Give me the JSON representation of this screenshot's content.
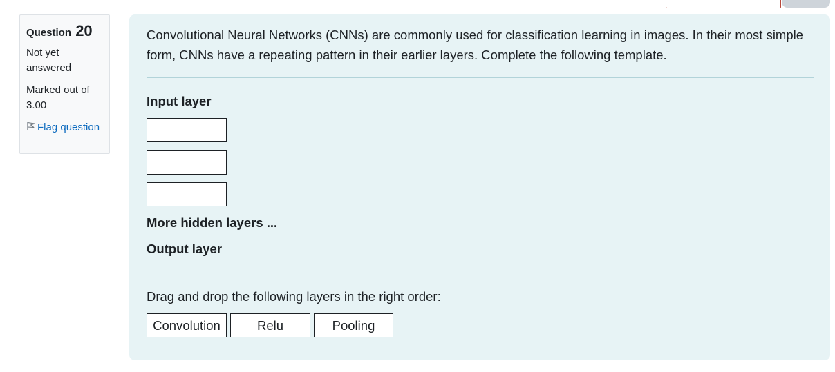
{
  "question": {
    "label": "Question",
    "number": "20",
    "state": "Not yet answered",
    "grade": "Marked out of 3.00",
    "flag_label": "Flag question"
  },
  "content": {
    "question_text": "Convolutional Neural Networks (CNNs) are commonly used for classification learning in images. In their most simple form, CNNs have a repeating pattern in their earlier layers. Complete the following template.",
    "input_layer": "Input layer",
    "more_layers": "More hidden layers ...",
    "output_layer": "Output layer",
    "instruction": "Drag and drop the following layers in the right order:",
    "choices": [
      "Convolution",
      "Relu",
      "Pooling"
    ]
  },
  "icons": {
    "flag": "flag-icon"
  },
  "colors": {
    "link": "#0f6cbf",
    "formulation_bg": "#e7f3f5",
    "info_bg": "#f8f9fa",
    "danger_border": "#b8493c"
  }
}
